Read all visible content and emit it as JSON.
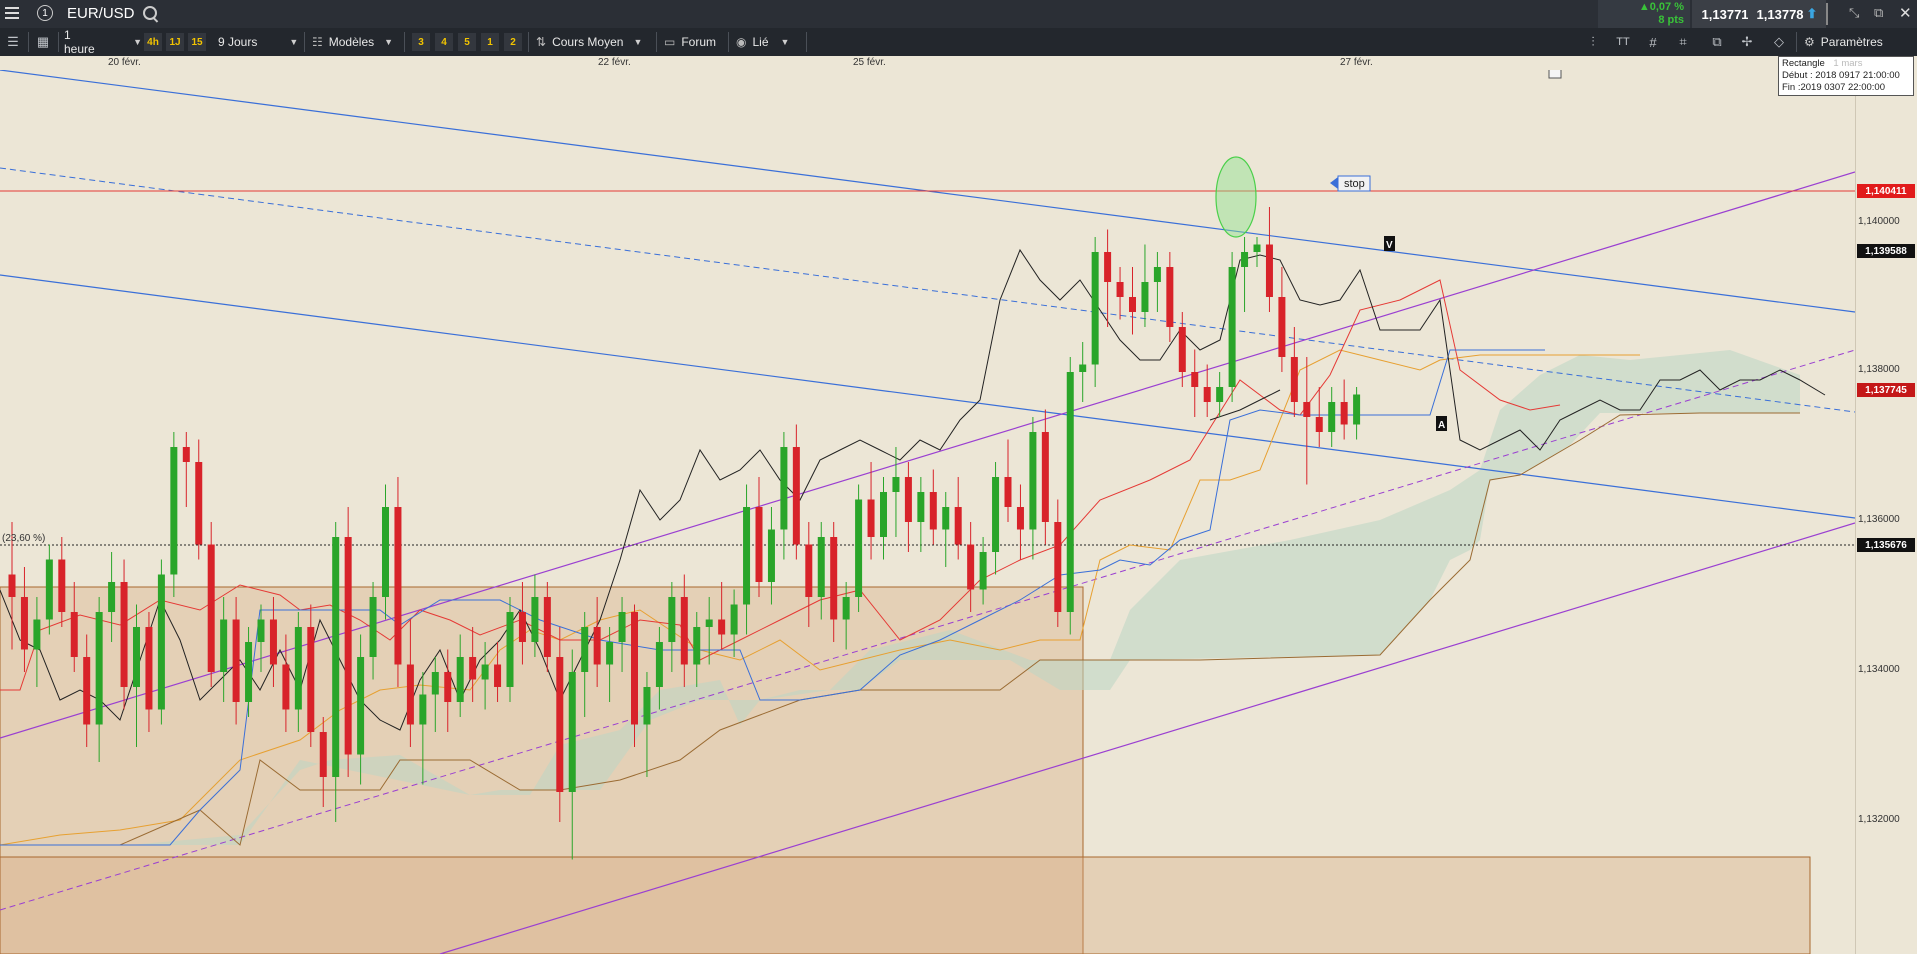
{
  "window": {
    "symbol": "EUR/USD",
    "alert_count": "1",
    "change_pct": "▲0,07 %",
    "change_pts": "8 pts",
    "sell_price": "1,13771",
    "buy_price": "1,13778"
  },
  "toolbar": {
    "timeframe": "1 heure",
    "quick_frames": [
      "4h",
      "1J",
      "15"
    ],
    "range": "9 Jours",
    "templates": "Modèles",
    "layouts": [
      "3",
      "4",
      "5",
      "1",
      "2"
    ],
    "price_mode": "Cours Moyen",
    "forum": "Forum",
    "linked": "Lié",
    "settings": "Paramètres"
  },
  "info_box": {
    "line1": "Rectangle",
    "line1_faded": "1 mars",
    "line2": "Début : 2018 0917 21:00:00",
    "line3": "Fin :2019 0307 22:00:00"
  },
  "annotations": {
    "stop_label": "stop",
    "fib_label": "(23,60 %)",
    "marker_v": "V",
    "marker_a": "A"
  },
  "colors": {
    "background": "#ece6d6",
    "bull": "#2aa52a",
    "bear": "#d8232a",
    "resistance": "#e53935",
    "channel_blue": "#3a6fd8",
    "channel_purple": "#9a3fd1",
    "tenkan": "#e53935",
    "kijun": "#3a6fd8",
    "senkou_a": "#e7a031",
    "senkou_b": "#9a6b33",
    "chikou": "#222222",
    "rect_fill": "#d7a77a"
  },
  "chart_data": {
    "type": "candlestick",
    "title": "EUR/USD",
    "interval": "1 heure",
    "x_tick_labels": [
      "20 févr.",
      "22 févr.",
      "25 févr.",
      "27 févr."
    ],
    "y_tick_labels": [
      "1,140000",
      "1,138000",
      "1,136000",
      "1,134000",
      "1,132000"
    ],
    "ylim": [
      1.13,
      1.142
    ],
    "price_labels": [
      {
        "value": "1,140411",
        "role": "resistance"
      },
      {
        "value": "1,139588",
        "role": "level"
      },
      {
        "value": "1,137745",
        "role": "last price"
      },
      {
        "value": "1,135676",
        "role": "fibonacci 23,60 %"
      }
    ],
    "horizontal_levels": [
      1.140411,
      1.135676
    ],
    "candles": [
      [
        1.1353,
        1.136,
        1.1343,
        1.135
      ],
      [
        1.135,
        1.1354,
        1.134,
        1.1343
      ],
      [
        1.1343,
        1.135,
        1.1338,
        1.1347
      ],
      [
        1.1347,
        1.1357,
        1.1345,
        1.1355
      ],
      [
        1.1355,
        1.1358,
        1.1346,
        1.1348
      ],
      [
        1.1348,
        1.1352,
        1.134,
        1.1342
      ],
      [
        1.1342,
        1.1345,
        1.133,
        1.1333
      ],
      [
        1.1333,
        1.135,
        1.1328,
        1.1348
      ],
      [
        1.1348,
        1.1356,
        1.1344,
        1.1352
      ],
      [
        1.1352,
        1.1355,
        1.1335,
        1.1338
      ],
      [
        1.1338,
        1.1349,
        1.133,
        1.1346
      ],
      [
        1.1346,
        1.1348,
        1.1332,
        1.1335
      ],
      [
        1.1335,
        1.1355,
        1.1333,
        1.1353
      ],
      [
        1.1353,
        1.1372,
        1.135,
        1.137
      ],
      [
        1.137,
        1.1372,
        1.1362,
        1.1368
      ],
      [
        1.1368,
        1.1371,
        1.1355,
        1.1357
      ],
      [
        1.1357,
        1.136,
        1.1338,
        1.134
      ],
      [
        1.134,
        1.135,
        1.1336,
        1.1347
      ],
      [
        1.1347,
        1.135,
        1.1333,
        1.1336
      ],
      [
        1.1336,
        1.1346,
        1.1334,
        1.1344
      ],
      [
        1.1344,
        1.1349,
        1.134,
        1.1347
      ],
      [
        1.1347,
        1.135,
        1.1338,
        1.1341
      ],
      [
        1.1341,
        1.1345,
        1.1332,
        1.1335
      ],
      [
        1.1335,
        1.1348,
        1.1332,
        1.1346
      ],
      [
        1.1346,
        1.1349,
        1.133,
        1.1332
      ],
      [
        1.1332,
        1.1334,
        1.1322,
        1.1326
      ],
      [
        1.1326,
        1.136,
        1.132,
        1.1358
      ],
      [
        1.1358,
        1.1362,
        1.1326,
        1.1329
      ],
      [
        1.1329,
        1.1345,
        1.1325,
        1.1342
      ],
      [
        1.1342,
        1.1352,
        1.1339,
        1.135
      ],
      [
        1.135,
        1.1365,
        1.1347,
        1.1362
      ],
      [
        1.1362,
        1.1366,
        1.1338,
        1.1341
      ],
      [
        1.1341,
        1.1347,
        1.133,
        1.1333
      ],
      [
        1.1333,
        1.134,
        1.1325,
        1.1337
      ],
      [
        1.1337,
        1.1342,
        1.1332,
        1.134
      ],
      [
        1.134,
        1.1343,
        1.1332,
        1.1336
      ],
      [
        1.1336,
        1.1345,
        1.1334,
        1.1342
      ],
      [
        1.1342,
        1.1346,
        1.1336,
        1.1339
      ],
      [
        1.1339,
        1.1344,
        1.1335,
        1.1341
      ],
      [
        1.1341,
        1.1344,
        1.1336,
        1.1338
      ],
      [
        1.1338,
        1.135,
        1.1336,
        1.1348
      ],
      [
        1.1348,
        1.1352,
        1.1341,
        1.1344
      ],
      [
        1.1344,
        1.1353,
        1.1342,
        1.135
      ],
      [
        1.135,
        1.1352,
        1.134,
        1.1342
      ],
      [
        1.1342,
        1.1346,
        1.132,
        1.1324
      ],
      [
        1.1324,
        1.1343,
        1.1315,
        1.134
      ],
      [
        1.134,
        1.1348,
        1.1334,
        1.1346
      ],
      [
        1.1346,
        1.135,
        1.1338,
        1.1341
      ],
      [
        1.1341,
        1.1346,
        1.1336,
        1.1344
      ],
      [
        1.1344,
        1.135,
        1.134,
        1.1348
      ],
      [
        1.1348,
        1.1349,
        1.133,
        1.1333
      ],
      [
        1.1333,
        1.134,
        1.1326,
        1.1338
      ],
      [
        1.1338,
        1.1346,
        1.1335,
        1.1344
      ],
      [
        1.1344,
        1.1352,
        1.134,
        1.135
      ],
      [
        1.135,
        1.1353,
        1.1338,
        1.1341
      ],
      [
        1.1341,
        1.1348,
        1.1338,
        1.1346
      ],
      [
        1.1346,
        1.135,
        1.1341,
        1.1347
      ],
      [
        1.1347,
        1.1352,
        1.1343,
        1.1345
      ],
      [
        1.1345,
        1.1351,
        1.1342,
        1.1349
      ],
      [
        1.1349,
        1.1365,
        1.1345,
        1.1362
      ],
      [
        1.1362,
        1.1366,
        1.135,
        1.1352
      ],
      [
        1.1352,
        1.1362,
        1.1349,
        1.1359
      ],
      [
        1.1359,
        1.1372,
        1.1355,
        1.137
      ],
      [
        1.137,
        1.1373,
        1.1355,
        1.1357
      ],
      [
        1.1357,
        1.136,
        1.1346,
        1.135
      ],
      [
        1.135,
        1.136,
        1.1347,
        1.1358
      ],
      [
        1.1358,
        1.136,
        1.1344,
        1.1347
      ],
      [
        1.1347,
        1.1352,
        1.1343,
        1.135
      ],
      [
        1.135,
        1.1365,
        1.1348,
        1.1363
      ],
      [
        1.1363,
        1.1368,
        1.1355,
        1.1358
      ],
      [
        1.1358,
        1.1366,
        1.1355,
        1.1364
      ],
      [
        1.1364,
        1.137,
        1.1358,
        1.1366
      ],
      [
        1.1366,
        1.1368,
        1.1356,
        1.136
      ],
      [
        1.136,
        1.1366,
        1.1356,
        1.1364
      ],
      [
        1.1364,
        1.1367,
        1.1357,
        1.1359
      ],
      [
        1.1359,
        1.1364,
        1.1354,
        1.1362
      ],
      [
        1.1362,
        1.1366,
        1.1355,
        1.1357
      ],
      [
        1.1357,
        1.136,
        1.1348,
        1.1351
      ],
      [
        1.1351,
        1.1358,
        1.1349,
        1.1356
      ],
      [
        1.1356,
        1.1368,
        1.1353,
        1.1366
      ],
      [
        1.1366,
        1.1371,
        1.136,
        1.1362
      ],
      [
        1.1362,
        1.1365,
        1.1355,
        1.1359
      ],
      [
        1.1359,
        1.1374,
        1.1355,
        1.1372
      ],
      [
        1.1372,
        1.1375,
        1.1357,
        1.136
      ],
      [
        1.136,
        1.1363,
        1.1346,
        1.1348
      ],
      [
        1.1348,
        1.1382,
        1.1345,
        1.138
      ],
      [
        1.138,
        1.1384,
        1.1376,
        1.1381
      ],
      [
        1.1381,
        1.1398,
        1.1378,
        1.1396
      ],
      [
        1.1396,
        1.1399,
        1.1386,
        1.1392
      ],
      [
        1.1392,
        1.1394,
        1.1387,
        1.139
      ],
      [
        1.139,
        1.1394,
        1.1385,
        1.1388
      ],
      [
        1.1388,
        1.1397,
        1.1386,
        1.1392
      ],
      [
        1.1392,
        1.1396,
        1.1388,
        1.1394
      ],
      [
        1.1394,
        1.1396,
        1.1384,
        1.1386
      ],
      [
        1.1386,
        1.1388,
        1.1378,
        1.138
      ],
      [
        1.138,
        1.1383,
        1.1374,
        1.1378
      ],
      [
        1.1378,
        1.1381,
        1.1374,
        1.1376
      ],
      [
        1.1376,
        1.138,
        1.1374,
        1.1378
      ],
      [
        1.1378,
        1.1396,
        1.1376,
        1.1394
      ],
      [
        1.1394,
        1.1398,
        1.1388,
        1.1396
      ],
      [
        1.1396,
        1.1398,
        1.1394,
        1.1397
      ],
      [
        1.1397,
        1.1402,
        1.1388,
        1.139
      ],
      [
        1.139,
        1.1394,
        1.138,
        1.1382
      ],
      [
        1.1382,
        1.1386,
        1.1374,
        1.1376
      ],
      [
        1.1376,
        1.1382,
        1.1365,
        1.1374
      ],
      [
        1.1374,
        1.1378,
        1.137,
        1.1372
      ],
      [
        1.1372,
        1.1378,
        1.137,
        1.1376
      ],
      [
        1.1376,
        1.1379,
        1.1371,
        1.1373
      ],
      [
        1.1373,
        1.1378,
        1.1371,
        1.1377
      ]
    ],
    "annotations": [
      "stop",
      "V",
      "A",
      "(23,60 %)",
      "Rectangle"
    ]
  }
}
